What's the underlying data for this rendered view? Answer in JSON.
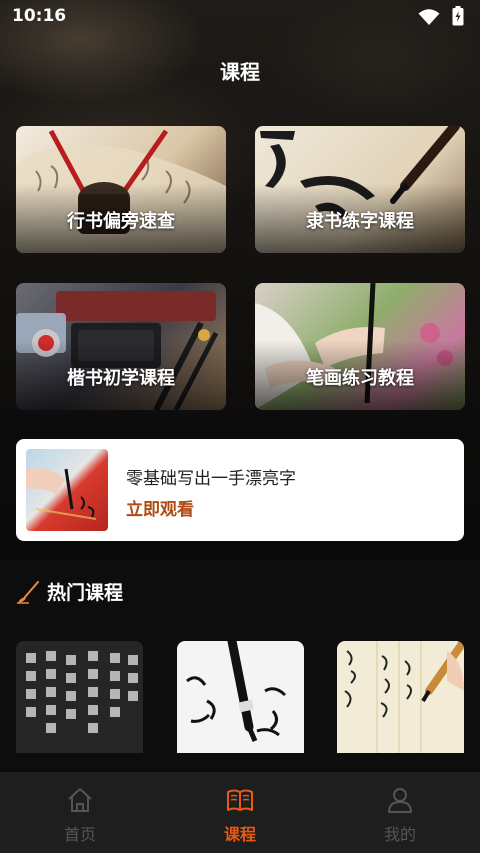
{
  "status_bar": {
    "time": "10:16"
  },
  "header": {
    "title": "课程"
  },
  "course_cards": [
    {
      "label": "行书偏旁速查"
    },
    {
      "label": "隶书练字课程"
    },
    {
      "label": "楷书初学课程"
    },
    {
      "label": "笔画练习教程"
    }
  ],
  "promo": {
    "title": "零基础写出一手漂亮字",
    "action": "立即观看",
    "action_color": "#b04a10"
  },
  "hot": {
    "title": "热门课程"
  },
  "bottom_nav": {
    "items": [
      {
        "label": "首页",
        "icon": "home-icon",
        "active": false
      },
      {
        "label": "课程",
        "icon": "book-icon",
        "active": true
      },
      {
        "label": "我的",
        "icon": "person-icon",
        "active": false
      }
    ],
    "active_color": "#e85a10",
    "inactive_color": "#555555"
  }
}
